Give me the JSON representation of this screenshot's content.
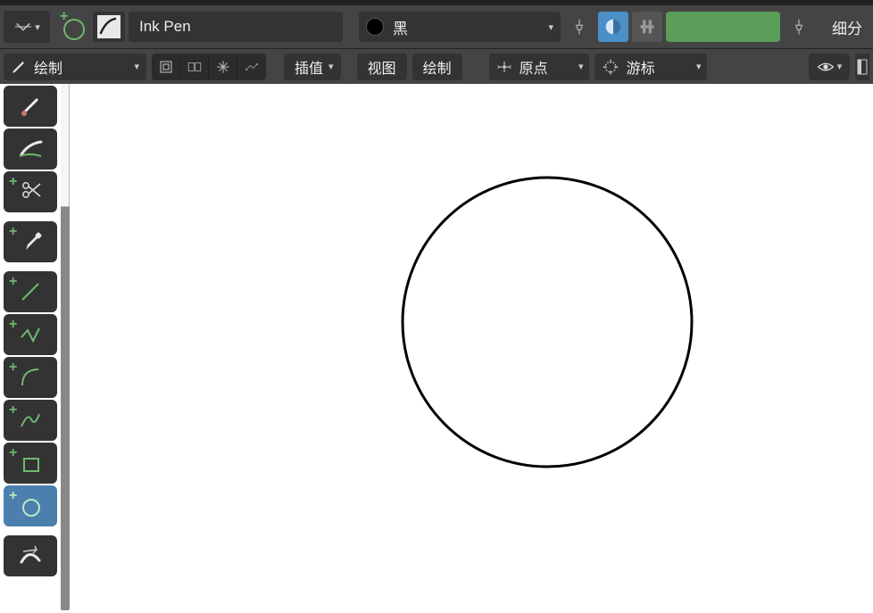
{
  "header": {
    "brush_name": "Ink Pen",
    "color_label": "黑",
    "right_button": "细分"
  },
  "toolbar2": {
    "mode_label": "绘制",
    "interp_label": "插值",
    "view_label": "视图",
    "draw_label": "绘制",
    "pivot_label": "原点",
    "cursor_label": "游标"
  },
  "tools": {
    "draw": "draw-tool",
    "fill": "fill-tool",
    "cutter": "cutter-tool",
    "eyedropper": "eyedropper-tool",
    "line": "line-tool",
    "polyline": "polyline-tool",
    "arc": "arc-tool",
    "curve": "curve-tool",
    "box": "box-tool",
    "circle": "circle-tool",
    "interpolate": "interpolate-tool"
  }
}
